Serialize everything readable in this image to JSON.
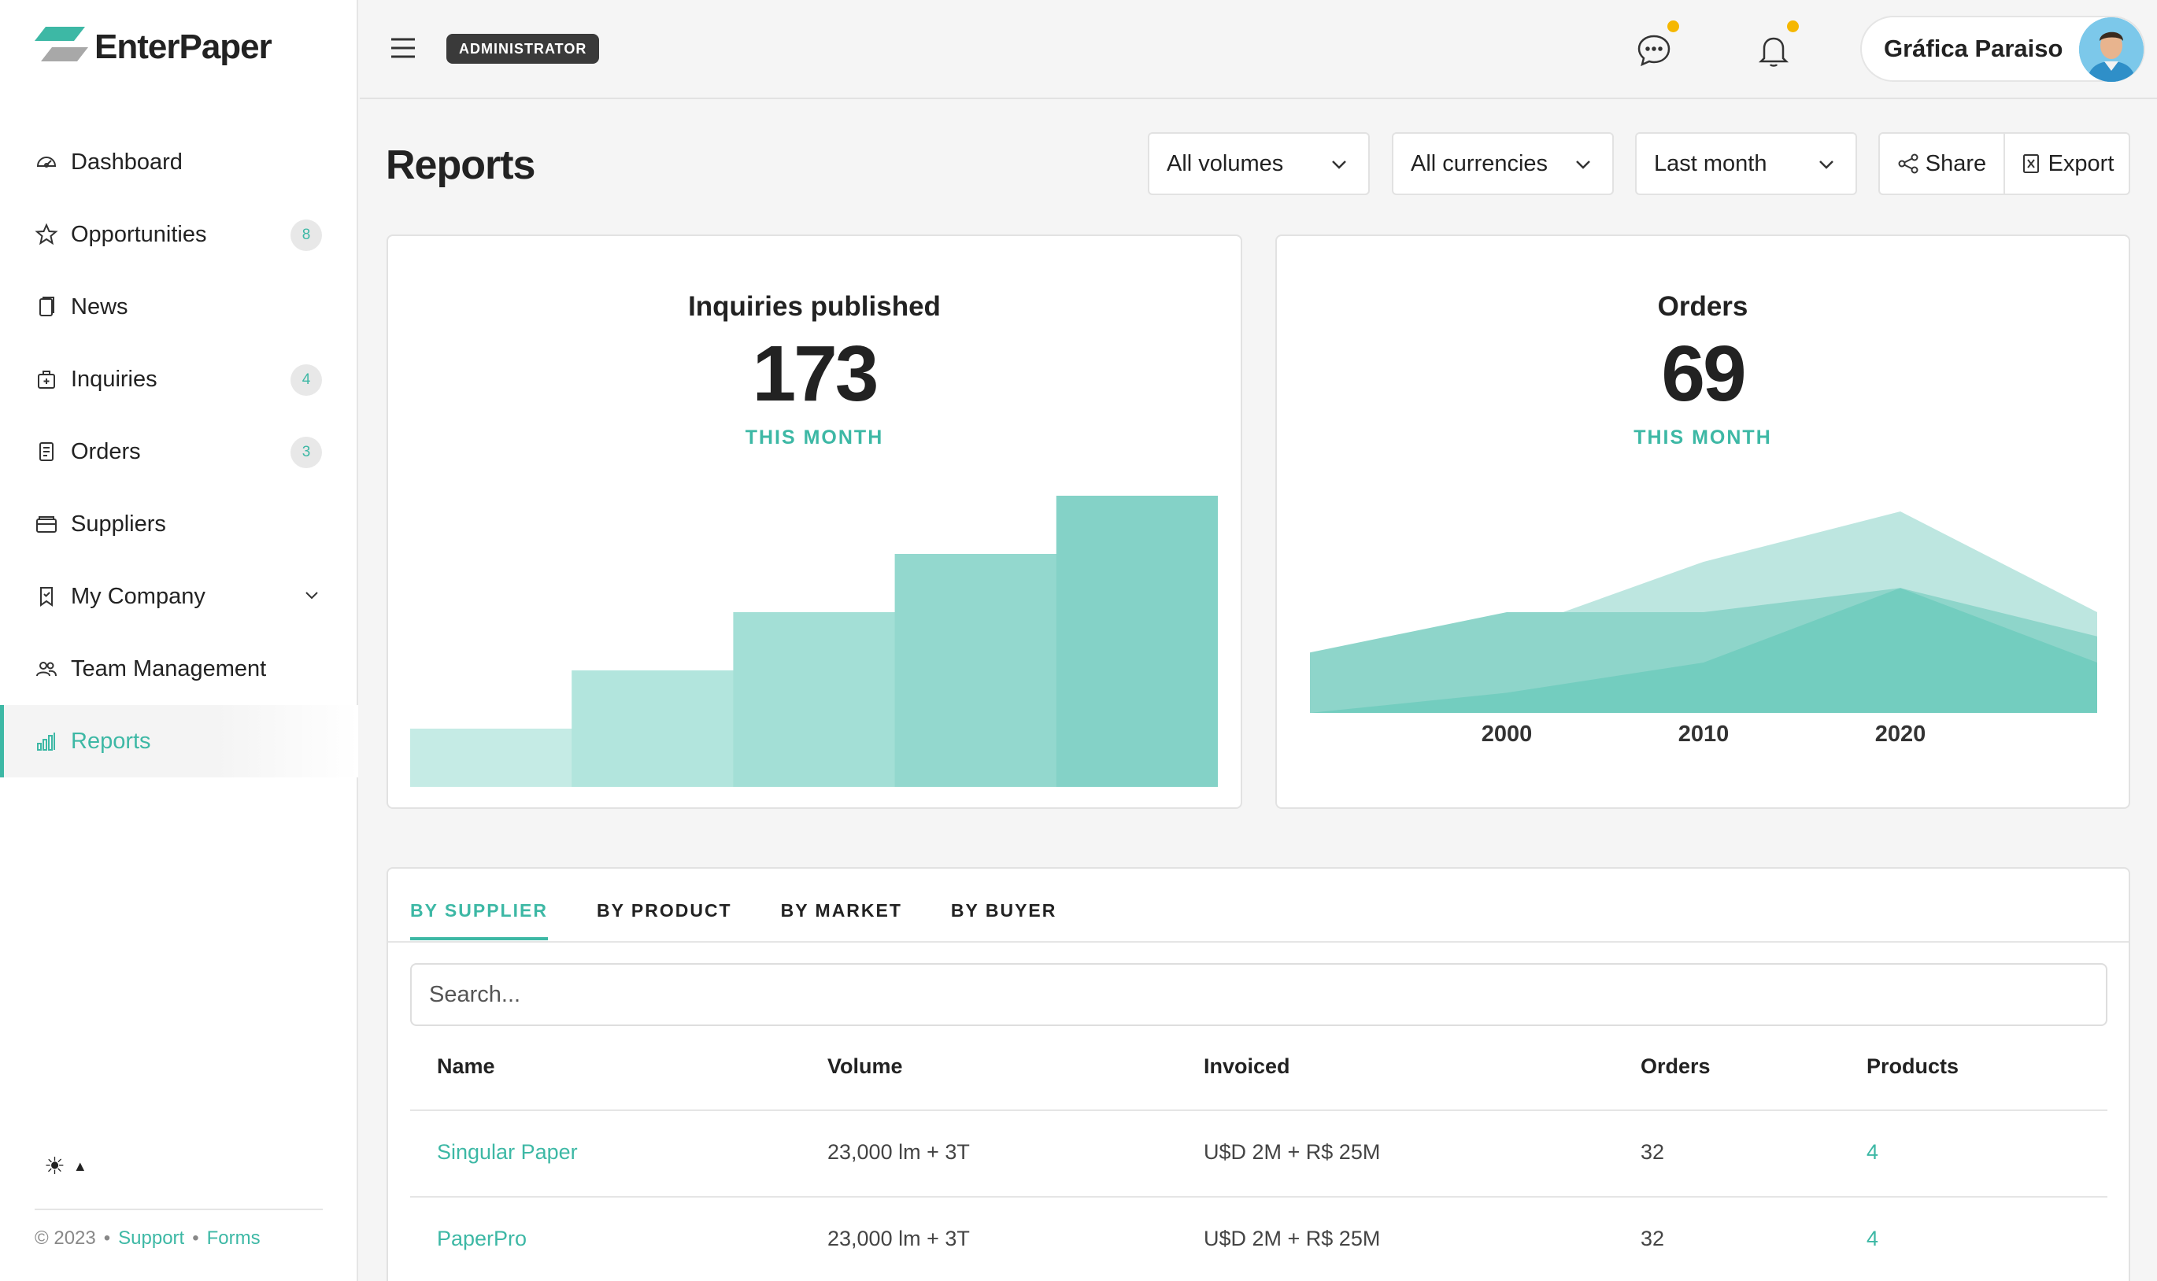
{
  "brand": {
    "name": "EnterPaper"
  },
  "sidebar": {
    "items": [
      {
        "label": "Dashboard",
        "icon": "dashboard-icon",
        "badge": ""
      },
      {
        "label": "Opportunities",
        "icon": "star-icon",
        "badge": "8"
      },
      {
        "label": "News",
        "icon": "news-icon",
        "badge": ""
      },
      {
        "label": "Inquiries",
        "icon": "inquiries-icon",
        "badge": "4"
      },
      {
        "label": "Orders",
        "icon": "orders-icon",
        "badge": "3"
      },
      {
        "label": "Suppliers",
        "icon": "suppliers-icon",
        "badge": ""
      },
      {
        "label": "My Company",
        "icon": "bookmark-icon",
        "badge": ""
      },
      {
        "label": "Team Management",
        "icon": "team-icon",
        "badge": ""
      },
      {
        "label": "Reports",
        "icon": "reports-icon",
        "badge": ""
      }
    ],
    "active": "Reports",
    "theme_icon": "☀",
    "footer": {
      "copyright": "© 2023",
      "separator": "•",
      "support": "Support",
      "forms": "Forms"
    }
  },
  "topbar": {
    "role": "ADMINISTRATOR",
    "user_name": "Gráfica Paraiso"
  },
  "page": {
    "title": "Reports",
    "filters": {
      "volumes": "All volumes",
      "currencies": "All currencies",
      "period": "Last month"
    },
    "actions": {
      "share": "Share",
      "export": "Export"
    }
  },
  "cards": {
    "inquiries": {
      "title": "Inquiries published",
      "value": "173",
      "subtitle": "THIS MONTH"
    },
    "orders": {
      "title": "Orders",
      "value": "69",
      "subtitle": "THIS MONTH"
    }
  },
  "table": {
    "tabs": [
      "BY SUPPLIER",
      "BY PRODUCT",
      "BY MARKET",
      "BY BUYER"
    ],
    "search_placeholder": "Search...",
    "columns": [
      "Name",
      "Volume",
      "Invoiced",
      "Orders",
      "Products"
    ],
    "rows": [
      {
        "name": "Singular Paper",
        "volume": "23,000 lm + 3T",
        "invoiced": "U$D 2M + R$ 25M",
        "orders": "32",
        "products": "4"
      },
      {
        "name": "PaperPro",
        "volume": "23,000 lm + 3T",
        "invoiced": "U$D 2M + R$ 25M",
        "orders": "32",
        "products": "4"
      }
    ]
  },
  "chart_data": [
    {
      "type": "bar",
      "values": [
        1,
        2,
        3,
        4,
        5
      ],
      "colors": [
        "#c5ebe5",
        "#b2e5dd",
        "#a3dfd6",
        "#93d8ce",
        "#84d2c7"
      ]
    },
    {
      "type": "area",
      "x_ticks": [
        "2000",
        "2010",
        "2020"
      ],
      "x": [
        1990,
        2000,
        2010,
        2020,
        2030
      ],
      "series": [
        {
          "values": [
            20,
            40,
            75,
            100,
            50
          ],
          "color": "#bde6e0"
        },
        {
          "values": [
            30,
            50,
            50,
            62,
            38
          ],
          "color": "#8ed5ca"
        },
        {
          "values": [
            0,
            10,
            25,
            62,
            25
          ],
          "color": "#6ecbbd"
        }
      ],
      "ylim": [
        0,
        100
      ],
      "accent": "#3db8a5"
    }
  ]
}
